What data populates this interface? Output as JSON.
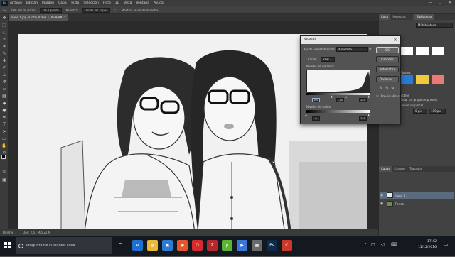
{
  "app": {
    "logo": "Ps",
    "menu": [
      "Archivo",
      "Edición",
      "Imagen",
      "Capa",
      "Texto",
      "Selección",
      "Filtro",
      "3D",
      "Vista",
      "Ventana",
      "Ayuda"
    ],
    "window_controls": [
      "—",
      "❐",
      "✕"
    ]
  },
  "options_bar": {
    "sample_size_label": "Tam. de muestra:",
    "sample_size_value": "De 1 punto",
    "sample_label": "Muestra:",
    "sample_value": "Todas las capas",
    "ring_label": "Mostrar anillo de muestra"
  },
  "document": {
    "tab_title": "nene 1.jpg al 77% (Capa 1, RGB/8#) *",
    "zoom": "76,96%",
    "doc_size": "Doc: 2,61 M/5,22 M"
  },
  "right_panel": {
    "tabs_top": [
      "Color",
      "Muestras"
    ],
    "tabs_lib": [
      "Bibliotecas"
    ],
    "lib_value": "Mi biblioteca",
    "adjust_note": "Ajustes",
    "style_note": "Estilos",
    "text1": "Crear un grupo de presets",
    "text2": "Desde un pincel",
    "val1": "0 px",
    "val2": "100 px",
    "layers_tabs": [
      "Capas",
      "Canales",
      "Trazados"
    ],
    "layers": [
      {
        "name": "Capa 1",
        "selected": true
      },
      {
        "name": "Fondo",
        "selected": false
      }
    ]
  },
  "levels_dialog": {
    "title": "Niveles",
    "close": "✕",
    "preset_label": "Ajuste preestablecido:",
    "preset_value": "A medida",
    "channel_label": "Canal:",
    "channel_value": "RGB",
    "input_label": "Niveles de entrada:",
    "input_black": "100",
    "input_gamma": "1,00",
    "input_white": "255",
    "output_label": "Niveles de salida:",
    "output_black": "0",
    "output_white": "255",
    "buttons": [
      "OK",
      "Cancelar",
      "Automático",
      "Opciones..."
    ],
    "preview_label": "Previsualizar"
  },
  "taskbar": {
    "search_placeholder": "Pregúntame cualquier cosa",
    "apps": [
      {
        "icon": "edge-icon",
        "glyph": "e",
        "color": "#1f6fd1"
      },
      {
        "icon": "folder-icon",
        "glyph": "▤",
        "color": "#e8b83a"
      },
      {
        "icon": "store-icon",
        "glyph": "▣",
        "color": "#2b7bd6"
      },
      {
        "icon": "chrome-icon",
        "glyph": "◉",
        "color": "#e4572e"
      },
      {
        "icon": "opera-icon",
        "glyph": "O",
        "color": "#d52b2b"
      },
      {
        "icon": "filezilla-icon",
        "glyph": "Z",
        "color": "#b5282e"
      },
      {
        "icon": "utorrent-icon",
        "glyph": "µ",
        "color": "#5cb531"
      },
      {
        "icon": "media-icon",
        "glyph": "▶",
        "color": "#3a77d8"
      },
      {
        "icon": "notes-icon",
        "glyph": "▦",
        "color": "#6a6a6a"
      },
      {
        "icon": "photoshop-icon",
        "glyph": "Ps",
        "color": "#0d2b4a"
      },
      {
        "icon": "ccleaner-icon",
        "glyph": "C",
        "color": "#c93a2b"
      }
    ],
    "time": "17:42",
    "date": "11/12/2016"
  }
}
